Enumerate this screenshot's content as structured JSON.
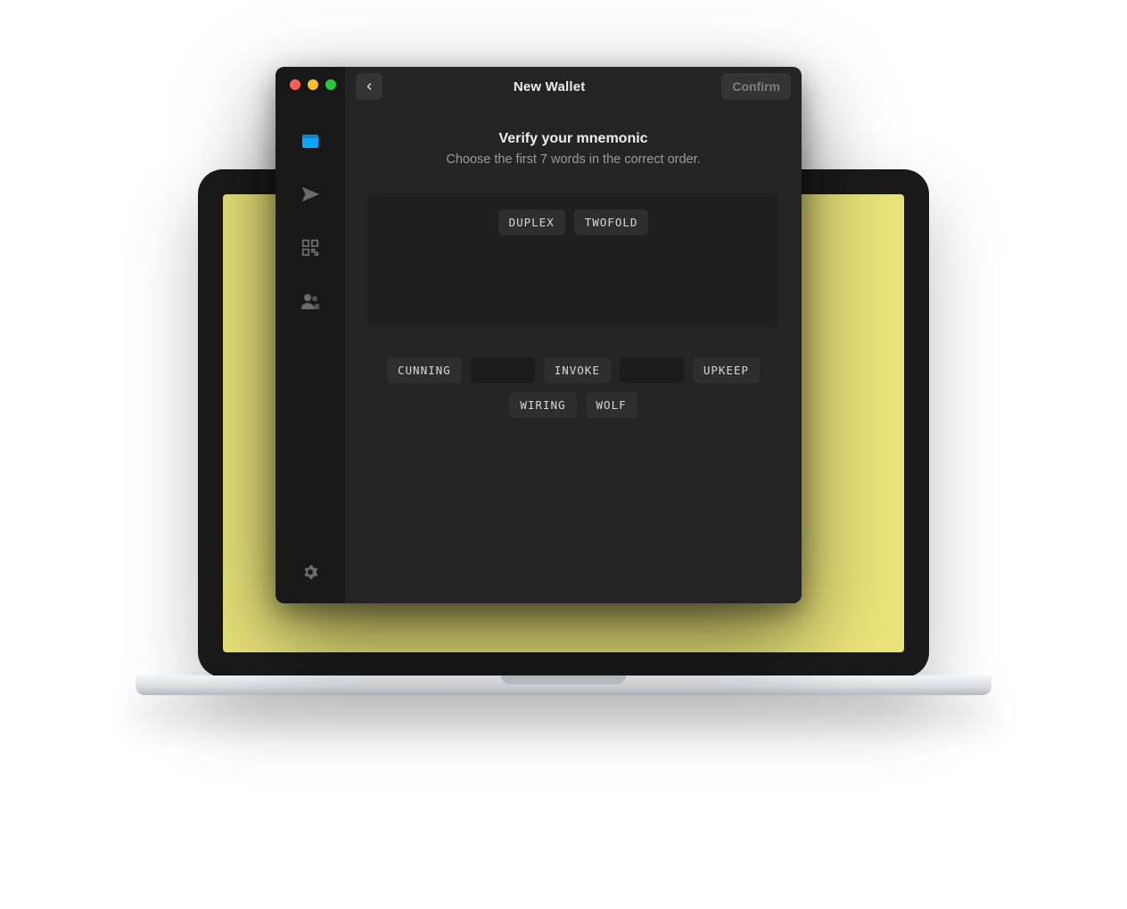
{
  "window": {
    "title": "New Wallet",
    "confirm_label": "Confirm"
  },
  "sidebar": {
    "items": [
      {
        "id": "wallet",
        "icon": "wallet-icon",
        "active": true
      },
      {
        "id": "send",
        "icon": "send-icon",
        "active": false
      },
      {
        "id": "receive",
        "icon": "qr-icon",
        "active": false
      },
      {
        "id": "contacts",
        "icon": "contacts-icon",
        "active": false
      }
    ],
    "settings": {
      "icon": "gear-icon"
    }
  },
  "verify": {
    "heading": "Verify your mnemonic",
    "subheading": "Choose the first 7 words in the correct order.",
    "selected": [
      "DUPLEX",
      "TWOFOLD"
    ],
    "pool_row1": [
      {
        "label": "CUNNING",
        "empty": false
      },
      {
        "label": "",
        "empty": true
      },
      {
        "label": "INVOKE",
        "empty": false
      },
      {
        "label": "",
        "empty": true
      },
      {
        "label": "UPKEEP",
        "empty": false
      }
    ],
    "pool_row2": [
      {
        "label": "WIRING",
        "empty": false
      },
      {
        "label": "WOLF",
        "empty": false
      }
    ]
  }
}
